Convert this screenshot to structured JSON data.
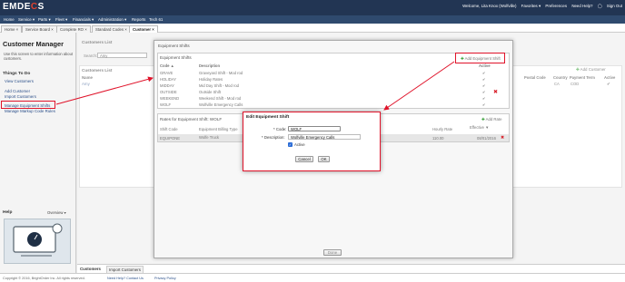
{
  "app": {
    "logo_text_left": "EMDE",
    "logo_text_o": "C",
    "logo_text_right": "S",
    "user_greeting": "Welcome, Lita Knox (Wolfville)",
    "favorites": "Favorites ▾",
    "preferences": "Preferences",
    "need_help": "Need Help?",
    "sign_out": "Sign Out"
  },
  "nav": [
    "Home",
    "Service ▾",
    "Parts ▾",
    "Fleet ▾",
    "Financials ▾",
    "Administration ▾",
    "Reports",
    "Tech 61"
  ],
  "tabs": [
    {
      "label": "Home",
      "active": false
    },
    {
      "label": "Service Board",
      "active": false
    },
    {
      "label": "Complete RO",
      "active": false
    },
    {
      "label": "Standard Codes",
      "active": false
    },
    {
      "label": "Customer",
      "active": true
    }
  ],
  "left": {
    "title": "Customer Manager",
    "description": "Use this screen to enter information about customers.",
    "things_to_do": "Things To Do",
    "view_customers": "View Customers",
    "add_customer": "Add Customer",
    "import_customers": "Import Customers",
    "manage_equipment_shifts": "Manage Equipment Shifts",
    "manage_markup_code_rules": "Manage Markup Code Rules",
    "help": "Help",
    "overview": "Overview"
  },
  "customers_list": {
    "title": "Customers List",
    "search_label": "Search:",
    "search_value": "Amy",
    "list_title": "Customers List",
    "name_header": "Name",
    "row_name": "Amy",
    "add_customer": "Add Customer",
    "columns": [
      "Postal Code",
      "Country",
      "Payment Term",
      "Active"
    ],
    "row_values": [
      "",
      "CA",
      "COD",
      "✔"
    ]
  },
  "equipment_shifts": {
    "dialog_title": "Equipment Shifts",
    "section_title": "Equipment Shifts",
    "add_button": "Add Equipment Shift",
    "col_code": "Code",
    "col_desc": "Description",
    "col_active": "Active",
    "rows": [
      {
        "code": "GRAVE",
        "desc": "Graveyard Shift - Mod rod",
        "active": "✔"
      },
      {
        "code": "HOLIDAY",
        "desc": "Holiday Rates",
        "active": "✔"
      },
      {
        "code": "MIDDAY",
        "desc": "Mid Day Shift - Mod rod",
        "active": "✔"
      },
      {
        "code": "OUTSIDE",
        "desc": "Outside Shift",
        "active": "✔"
      },
      {
        "code": "WEEKEND",
        "desc": "Weekend Shift - Mod rod",
        "active": "✔"
      },
      {
        "code": "WOLF",
        "desc": "Wolfville Emergency Calls",
        "active": "✔"
      }
    ],
    "rates_title": "Rates for Equipment Shift: WOLF",
    "add_rate": "Add Rate",
    "rates_cols": [
      "Shift Code",
      "Equipment Billing Type",
      "Hourly Rate",
      "Effective"
    ],
    "rates_row": [
      "EQUIPONE",
      "Wolfe Truck",
      "110.00",
      "08/01/2016"
    ],
    "done_button": "Done"
  },
  "edit_dialog": {
    "title": "Edit Equipment Shift",
    "code_label": "* Code:",
    "code_value": "WOLF",
    "desc_label": "* Description:",
    "desc_value": "Wolfville Emergency Calls",
    "active_label": "Active",
    "active_checked": true,
    "cancel": "Cancel",
    "ok": "OK"
  },
  "bottom_tabs": [
    "Customers",
    "Import Customers"
  ],
  "footer": {
    "copyright": "Copyright © 2016, BrightOrder Inc. All rights reserved.",
    "help_link": "Need Help? Contact Us",
    "privacy": "Privacy Policy"
  }
}
